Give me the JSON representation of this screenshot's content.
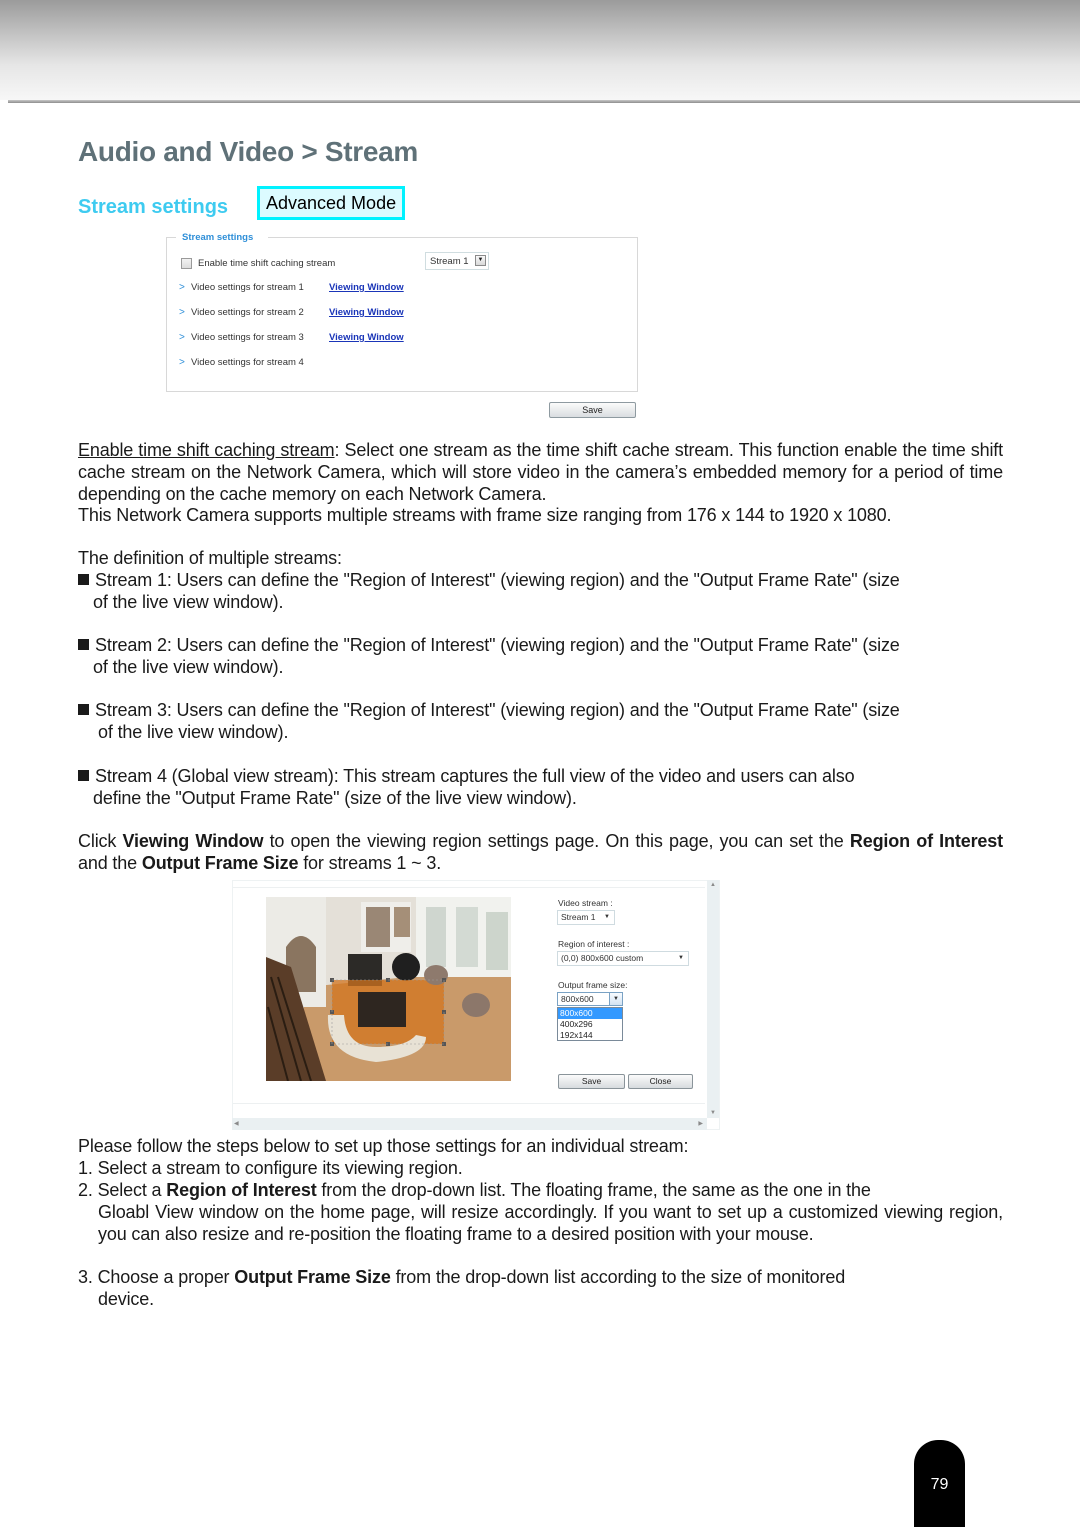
{
  "header": {
    "page_title": "Audio and Video > Stream",
    "section_title": "Stream settings",
    "badge": "Advanced Mode"
  },
  "stream_panel": {
    "legend": "Stream settings",
    "checkbox_label": "Enable time shift caching stream",
    "checkbox_checked": false,
    "stream_select_value": "Stream 1",
    "rows": [
      {
        "label": "Video settings for stream 1",
        "link": "Viewing Window"
      },
      {
        "label": "Video settings for stream 2",
        "link": "Viewing Window"
      },
      {
        "label": "Video settings for stream 3",
        "link": "Viewing Window"
      },
      {
        "label": "Video settings for stream 4",
        "link": ""
      }
    ],
    "save_label": "Save"
  },
  "body": {
    "p1_term": "Enable time shift caching stream",
    "p1_rest": ": Select one stream as the time shift cache stream. This function enable the time shift cache stream on the Network Camera, which will store video in the camera’s embedded memory for a period of time depending on the cache memory on each Network Camera.",
    "p2": "This Network Camera supports multiple streams with frame size ranging from 176 x 144 to 1920 x 1080.",
    "p3": "The definition of multiple streams:",
    "bullets": [
      {
        "first": "Stream 1: Users can define the \"Region of Interest\" (viewing region) and the \"Output Frame Rate\" (size",
        "cont": "of the live view window)."
      },
      {
        "first": "Stream 2: Users can define the \"Region of Interest\" (viewing region) and the \"Output Frame Rate\" (size",
        "cont": "of the live view window)."
      },
      {
        "first": "Stream 3: Users can define the \"Region of Interest\" (viewing region) and the \"Output Frame Rate\" (size",
        "cont": "of the live view window)."
      },
      {
        "first": "Stream 4 (Global view stream): This stream captures the full view of the video and users can also",
        "cont": "define the \"Output Frame Rate\" (size of the live view window)."
      }
    ],
    "click_p": {
      "t1": "Click ",
      "b1": "Viewing Window",
      "t2": " to open the viewing region settings page. On this page, you can set the ",
      "b2": "Region of Interest",
      "t3": " and the ",
      "b3": "Output Frame Size",
      "t4": " for streams 1 ~ 3."
    },
    "steps_intro": "Please follow the steps below to set up those settings for an individual stream:",
    "step1": "1. Select a stream to configure its viewing region.",
    "step2": {
      "t1": "2. Select a ",
      "b1": "Region of Interest",
      "t2": " from the drop-down list. The floating frame, the same as the one in the",
      "cont": "Gloabl View window on the home page, will resize accordingly. If you want to set up a customized viewing region, you can also resize and re-position the floating frame to a desired position with your mouse."
    },
    "step3": {
      "t1": "3. Choose a proper ",
      "b1": "Output Frame Size",
      "t2": " from the drop-down list according to the size of monitored",
      "cont": "device."
    }
  },
  "viewing_window": {
    "video_stream_label": "Video stream :",
    "video_stream_value": "Stream 1",
    "roi_label": "Region of interest :",
    "roi_value": "(0,0) 800x600 custom",
    "ofs_label": "Output frame size:",
    "ofs_value": "800x600",
    "ofs_options": [
      "800x600",
      "400x296",
      "192x144"
    ],
    "ofs_selected": "800x600",
    "save_label": "Save",
    "close_label": "Close"
  },
  "footer": {
    "page_number": "79"
  },
  "colors": {
    "title": "#5f7178",
    "section": "#3ecbf0",
    "badge_border": "#00f2ff",
    "link": "#1a35b8",
    "selected_option": "#3399ff"
  }
}
